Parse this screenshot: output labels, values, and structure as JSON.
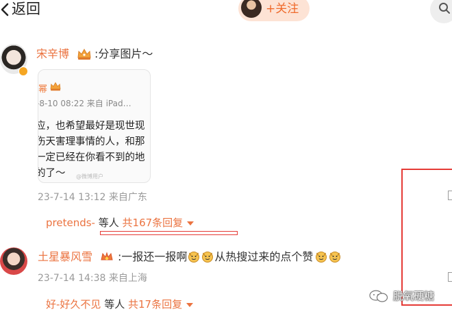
{
  "header": {
    "back_label": "返回",
    "follow_label": "+关注"
  },
  "comments": [
    {
      "user": "宋辛博",
      "text": ":分享图片～",
      "image_card": {
        "name_fragment": "幂",
        "meta": "-8-10 08:22  来自 iPad…",
        "lines": [
          "应，也希望最好是现世现",
          "伤天害理事情的人，和那",
          "一定已经在你看不到的地",
          "的了～"
        ],
        "watermark": "@微博用户"
      },
      "timestamp": "23-7-14 13:12 来自广东",
      "reply_summary": {
        "user": "pretends-",
        "mid": "等人",
        "count_text": "共167条回复"
      }
    },
    {
      "user": "土星暴风雪",
      "text_parts": [
        ":一报还一报啊",
        "从热搜过来的点个赞"
      ],
      "timestamp": "23-7-14 14:38 来自上海",
      "reply_summary": {
        "user": "好-好久不见",
        "mid": "等人",
        "count_text": "共17条回复"
      }
    }
  ],
  "watermark": {
    "text": "脱氧硬糖"
  },
  "colors": {
    "accent": "#eb7340",
    "annotation": "#e53935",
    "follow_bg": "#fde3d5"
  },
  "icons": [
    "chevron-left-icon",
    "search-icon",
    "crown-icon",
    "emoji-dog-icon",
    "caret-down-icon",
    "wechat-logo-icon"
  ]
}
